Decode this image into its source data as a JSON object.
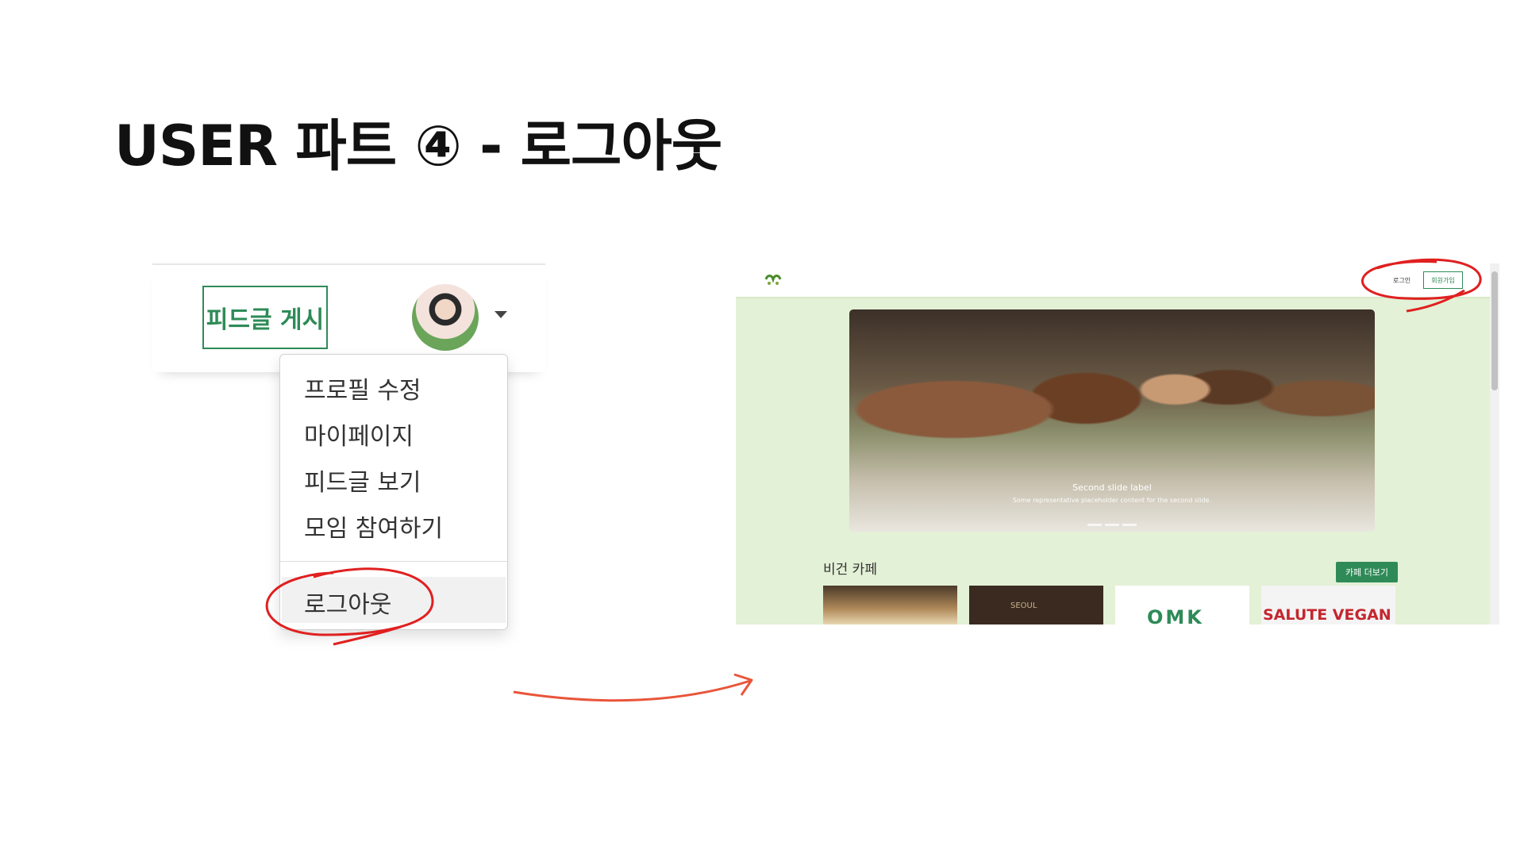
{
  "slide": {
    "title": "USER 파트 ④ - 로그아웃"
  },
  "left": {
    "feed_post_button": "피드글 게시",
    "dropdown": {
      "items": [
        "프로필 수정",
        "마이페이지",
        "피드글 보기",
        "모임 참여하기"
      ],
      "logout": "로그아웃"
    }
  },
  "right": {
    "nav": {
      "login": "로그인",
      "signup": "회원가입"
    },
    "carousel": {
      "title": "Second slide label",
      "text": "Some representative placeholder content for the second slide."
    },
    "section": {
      "title": "비건 카페",
      "more_button": "카페 더보기"
    },
    "cards": {
      "card2_sign": "SEOUL",
      "card3_logo": "OMK",
      "card4_sign": "SALUTE VEGAN"
    }
  },
  "colors": {
    "brand_green": "#2e8b57",
    "annotation_red": "#e02020",
    "arrow_orange": "#e9553a"
  },
  "icons": [
    "avatar",
    "caret-down-icon",
    "logo-icon",
    "chevron-left-icon",
    "chevron-right-icon"
  ]
}
